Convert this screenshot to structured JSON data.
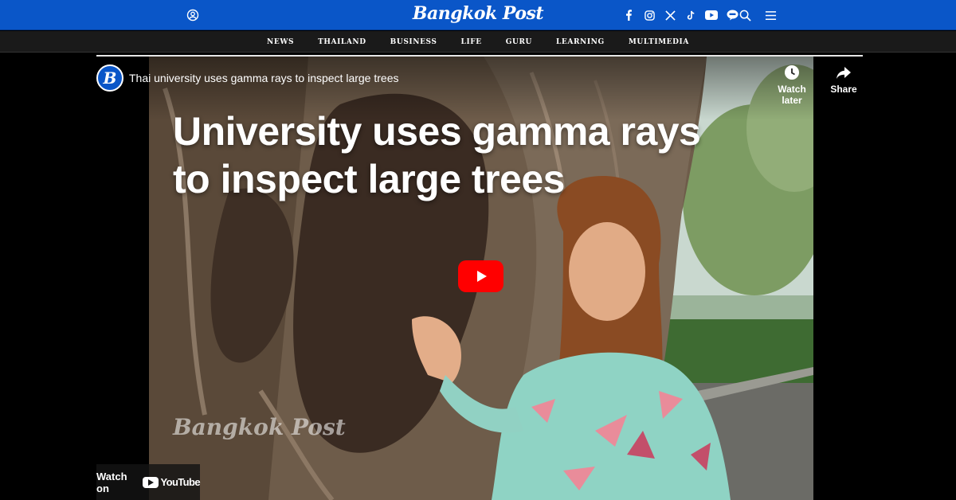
{
  "header": {
    "logo_text": "Bangkok Post",
    "social": [
      "facebook-icon",
      "instagram-icon",
      "x-icon",
      "tiktok-icon",
      "youtube-icon",
      "line-icon"
    ]
  },
  "nav": {
    "items": [
      {
        "label": "NEWS"
      },
      {
        "label": "THAILAND"
      },
      {
        "label": "BUSINESS"
      },
      {
        "label": "LIFE"
      },
      {
        "label": "GURU"
      },
      {
        "label": "LEARNING"
      },
      {
        "label": "MULTIMEDIA"
      }
    ]
  },
  "video": {
    "channel_avatar_letter": "B",
    "title": "Thai university uses gamma rays to inspect large trees",
    "watch_later_label": "Watch later",
    "share_label": "Share",
    "headline_line1": "University uses gamma rays",
    "headline_line2": "to inspect large trees",
    "watermark": "Bangkok Post",
    "watch_on_label": "Watch on",
    "youtube_word": "YouTube"
  },
  "colors": {
    "brand_blue": "#0a56c8",
    "nav_bg": "#1a1a1a",
    "play_red": "#ff0000"
  }
}
